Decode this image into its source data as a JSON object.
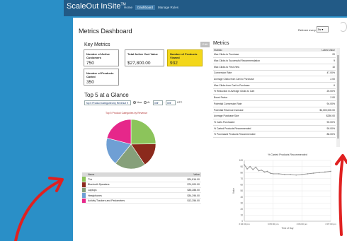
{
  "app": {
    "brand": "ScaleOut InSite",
    "brand_mark": "TM",
    "nav": [
      {
        "label": "Home",
        "active": false
      },
      {
        "label": "Dashboard",
        "active": true
      },
      {
        "label": "Manage Rules",
        "active": false
      }
    ]
  },
  "page": {
    "title": "Metrics Dashboard",
    "refresh_label": "Refresh every",
    "refresh_value": "5s"
  },
  "key_metrics": {
    "title": "Key Metrics",
    "edit_label": "Edit",
    "cards": [
      {
        "label": "Number of Active Customers",
        "value": "750",
        "highlight": false
      },
      {
        "label": "Total Active Cart Value",
        "value": "$27,800.00",
        "highlight": false
      },
      {
        "label": "Number of Products Viewed",
        "value": "932",
        "highlight": true
      },
      {
        "label": "Number of Products Carted",
        "value": "350",
        "highlight": false
      }
    ]
  },
  "top5": {
    "title": "Top 5 at a Glance",
    "category_select": "Top 5 Product Categories by Revenue",
    "now_label": "Now",
    "at_label": "At",
    "hour": "00",
    "minute": "00",
    "tz": "UTC",
    "pie_title": "Top 5 Product Categories by Revenue",
    "table_headers": {
      "name": "Name",
      "value": "Value"
    },
    "rows": [
      {
        "name": "TVs",
        "value": "$24,816.00",
        "color": "#8cc45b"
      },
      {
        "name": "Bluetooth Speakers",
        "value": "$74,000.00",
        "color": "#8b2a1c"
      },
      {
        "name": "Laptops",
        "value": "$35,288.00",
        "color": "#86a07a"
      },
      {
        "name": "Headphones",
        "value": "$34,296.00",
        "color": "#6f9fd4"
      },
      {
        "name": "Activity Trackers and Pedometers",
        "value": "$12,256.00",
        "color": "#e6278a"
      }
    ]
  },
  "metrics": {
    "title": "Metrics",
    "headers": {
      "statistic": "Statistic",
      "value": "Latest Value"
    },
    "rows": [
      {
        "name": "Max Clicks to Purchase",
        "value": "20"
      },
      {
        "name": "Max Clicks to Successful Recommendation",
        "value": "9"
      },
      {
        "name": "Max Clicks to First View",
        "value": "10"
      },
      {
        "name": "Conversion Rate",
        "value": "47.00%"
      },
      {
        "name": "Average Clicks from Cart to Purchase",
        "value": "2.00"
      },
      {
        "name": "Max Clicks from Cart to Purchase",
        "value": "6"
      },
      {
        "name": "% Reduction in Average Clicks to Cart",
        "value": "25.00%"
      },
      {
        "name": "Boost Factor",
        "value": "2.00"
      },
      {
        "name": "Potential Conversion Rate",
        "value": "94.00%"
      },
      {
        "name": "Potential Revenue Increase",
        "value": "$2,000,000.00"
      },
      {
        "name": "Average Purchase Size",
        "value": "$250.00"
      },
      {
        "name": "% Carts Purchased",
        "value": "90.00%"
      },
      {
        "name": "% Carted Products Recommended",
        "value": "90.00%"
      },
      {
        "name": "% Purchased Products Recommended",
        "value": "88.00%"
      }
    ]
  },
  "chart_data": [
    {
      "type": "pie",
      "title": "Top 5 Product Categories by Revenue",
      "labels": [
        "TVs",
        "Bluetooth Speakers",
        "Laptops",
        "Headphones",
        "Activity Trackers and Pedometers"
      ],
      "values": [
        24.8,
        15.8,
        20.2,
        18.2,
        21.0
      ],
      "colors": [
        "#8cc45b",
        "#8b2a1c",
        "#86a07a",
        "#6f9fd4",
        "#e6278a"
      ]
    },
    {
      "type": "line",
      "title": "% Carted Products Recommended",
      "xlabel": "Time of Day",
      "ylabel": "Value",
      "ylim": [
        0,
        100
      ],
      "yticks": [
        0,
        10,
        20,
        30,
        40,
        50,
        60,
        70,
        80,
        90,
        100
      ],
      "xticks": [
        "3:04:00 pm",
        "3:05:00 pm",
        "3:06:00 pm",
        "3:07:00 pm"
      ],
      "xlim": [
        0,
        3
      ],
      "series": [
        {
          "x": [
            0,
            0.1,
            0.2,
            0.3,
            0.4,
            0.5,
            0.6,
            0.7,
            0.8,
            0.9,
            1.0,
            1.2,
            1.4,
            1.6,
            1.8,
            2.0,
            2.2,
            2.4,
            2.6,
            2.8,
            3.0
          ],
          "y": [
            93,
            86,
            90,
            85,
            89,
            83,
            84,
            81,
            82,
            79,
            78,
            78,
            77,
            77,
            76,
            77,
            78,
            79,
            80,
            81,
            82
          ],
          "color": "#8f8f8f"
        }
      ]
    }
  ]
}
